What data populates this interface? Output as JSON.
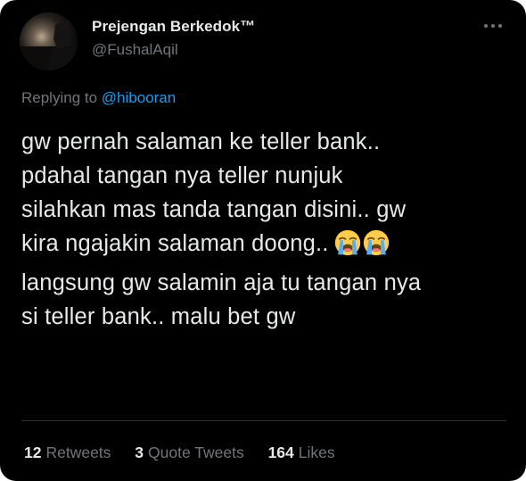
{
  "tweet": {
    "author": {
      "display_name": "Prejengan Berkedok™",
      "handle": "@FushalAqil"
    },
    "more_icon": "three-dots-icon",
    "reply_to": {
      "prefix": "Replying to",
      "mention": "@hibooran"
    },
    "text_lines": [
      "gw pernah salaman ke teller bank..",
      "pdahal tangan nya teller nunjuk",
      "silahkan mas tanda tangan disini.. gw",
      "kira ngajakin salaman doong..",
      "langsung gw salamin aja tu tangan nya",
      "si teller bank.. malu bet gw"
    ],
    "emojis": [
      "loudly-crying-face-icon",
      "loudly-crying-face-icon"
    ],
    "stats": [
      {
        "count": "12",
        "label": "Retweets"
      },
      {
        "count": "3",
        "label": "Quote Tweets"
      },
      {
        "count": "164",
        "label": "Likes"
      }
    ],
    "colors": {
      "background": "#000000",
      "text": "#e7e9ea",
      "secondary": "#71767b",
      "link": "#1d9bf0"
    }
  }
}
